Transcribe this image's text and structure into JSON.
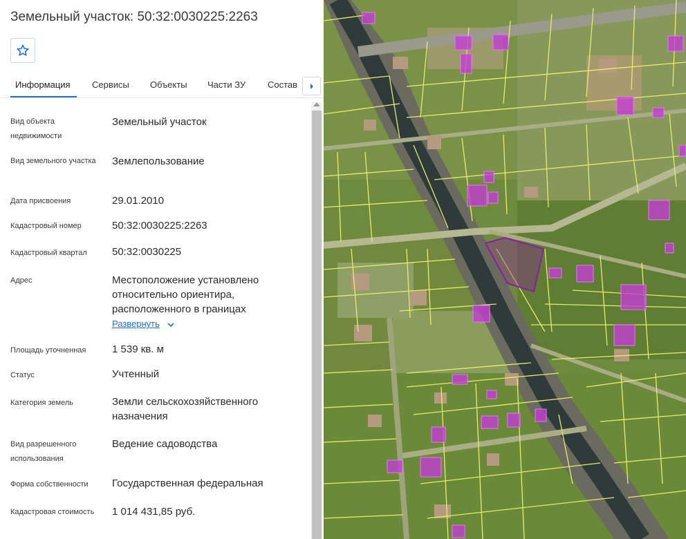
{
  "panel": {
    "title": "Земельный участок: 50:32:0030225:2263",
    "tabs": [
      "Информация",
      "Сервисы",
      "Объекты",
      "Части ЗУ",
      "Состав"
    ],
    "active_tab": "Информация",
    "fields": [
      {
        "label": "Вид объекта недвижимости",
        "value": "Земельный участок"
      },
      {
        "label": "Вид земельного участка",
        "value": "Землепользование"
      },
      {
        "label": "Дата присвоения",
        "value": "29.01.2010"
      },
      {
        "label": "Кадастровый номер",
        "value": "50:32:0030225:2263"
      },
      {
        "label": "Кадастровый квартал",
        "value": "50:32:0030225"
      },
      {
        "label": "Адрес",
        "value": "Местоположение установлено относительно ориентира, расположенного в границах"
      },
      {
        "label": "Площадь уточненная",
        "value": "1 539 кв. м"
      },
      {
        "label": "Статус",
        "value": "Учтенный"
      },
      {
        "label": "Категория земель",
        "value": "Земли сельскохозяйственного назначения"
      },
      {
        "label": "Вид разрешенного использования",
        "value": "Ведение садоводства"
      },
      {
        "label": "Форма собственности",
        "value": "Государственная федеральная"
      },
      {
        "label": "Кадастровая стоимость",
        "value": "1 014 431,85 руб."
      }
    ],
    "expand_label": "Развернуть"
  },
  "colors": {
    "accent": "#1a6fd6",
    "parcel_line": "#e8ec6a",
    "building_fill": "#c43bd6",
    "selected_parcel": "#8a1fa0"
  },
  "icons": {
    "favorite": "star-icon",
    "tabs_next": "caret-right-icon",
    "expand": "chevron-down-icon"
  }
}
